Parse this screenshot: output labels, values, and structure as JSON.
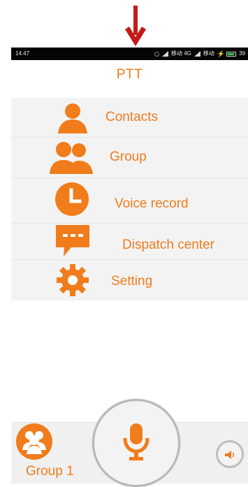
{
  "statusbar": {
    "time": "14:47",
    "network_1": "移动 4G",
    "network_2": "移动",
    "battery": "39"
  },
  "app": {
    "title": "PTT"
  },
  "menu": {
    "items": [
      {
        "label": "Contacts",
        "icon": "person-icon"
      },
      {
        "label": "Group",
        "icon": "group-icon"
      },
      {
        "label": "Voice record",
        "icon": "clock-icon"
      },
      {
        "label": "Dispatch center",
        "icon": "chat-bubble-icon"
      },
      {
        "label": "Setting",
        "icon": "gear-icon"
      }
    ]
  },
  "bottom": {
    "group_label": "Group 1",
    "ptt_icon": "microphone-icon",
    "speaker_icon": "speaker-icon"
  },
  "colors": {
    "accent": "#f07c1b",
    "panel": "#f3f3f3",
    "statusbar": "#050505"
  }
}
